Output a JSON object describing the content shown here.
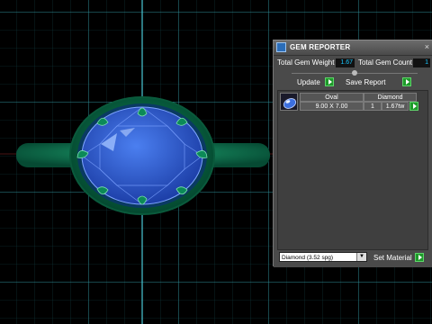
{
  "panel": {
    "title": "GEM REPORTER",
    "close_glyph": "×",
    "total_weight_label": "Total Gem Weight",
    "total_weight_value": "1.67",
    "total_count_label": "Total Gem Count",
    "total_count_value": "1",
    "update_label": "Update",
    "save_report_label": "Save Report"
  },
  "gem_table": {
    "headers": [
      "Oval",
      "Diamond"
    ],
    "rows": [
      {
        "size": "9.00 X 7.00",
        "qty": "1",
        "weight": "1.67tw"
      }
    ]
  },
  "footer": {
    "material_selected": "Diamond     (3.52 spg)",
    "select_arrow_glyph": "▼",
    "set_material_label": "Set Material"
  },
  "colors": {
    "gem_blue": "#2f5fd0",
    "metal_green": "#0f7a52",
    "grid": "#1f6f75",
    "axis": "#49c9d6",
    "panel_bg": "#4a4a4a",
    "value_text": "#19c7ff",
    "button_green": "#1e9a2a"
  },
  "icons": {
    "panel_icon": "gem-reporter-icon",
    "row_icon": "oval-gem-icon",
    "go_icon": "play-arrow-icon"
  }
}
